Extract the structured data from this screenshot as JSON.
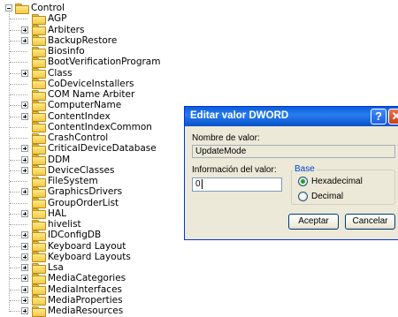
{
  "tree": {
    "root": "Control",
    "items": [
      {
        "label": "AGP",
        "expandable": false
      },
      {
        "label": "Arbiters",
        "expandable": true
      },
      {
        "label": "BackupRestore",
        "expandable": true
      },
      {
        "label": "Biosinfo",
        "expandable": false
      },
      {
        "label": "BootVerificationProgram",
        "expandable": false
      },
      {
        "label": "Class",
        "expandable": true
      },
      {
        "label": "CoDeviceInstallers",
        "expandable": false
      },
      {
        "label": "COM Name Arbiter",
        "expandable": false
      },
      {
        "label": "ComputerName",
        "expandable": true
      },
      {
        "label": "ContentIndex",
        "expandable": true
      },
      {
        "label": "ContentIndexCommon",
        "expandable": false
      },
      {
        "label": "CrashControl",
        "expandable": false
      },
      {
        "label": "CriticalDeviceDatabase",
        "expandable": true
      },
      {
        "label": "DDM",
        "expandable": true
      },
      {
        "label": "DeviceClasses",
        "expandable": true
      },
      {
        "label": "FileSystem",
        "expandable": false
      },
      {
        "label": "GraphicsDrivers",
        "expandable": true
      },
      {
        "label": "GroupOrderList",
        "expandable": false
      },
      {
        "label": "HAL",
        "expandable": true
      },
      {
        "label": "hivelist",
        "expandable": false
      },
      {
        "label": "IDConfigDB",
        "expandable": true
      },
      {
        "label": "Keyboard Layout",
        "expandable": true
      },
      {
        "label": "Keyboard Layouts",
        "expandable": true
      },
      {
        "label": "Lsa",
        "expandable": true
      },
      {
        "label": "MediaCategories",
        "expandable": true
      },
      {
        "label": "MediaInterfaces",
        "expandable": true
      },
      {
        "label": "MediaProperties",
        "expandable": true
      },
      {
        "label": "MediaResources",
        "expandable": true
      }
    ]
  },
  "dialog": {
    "title": "Editar valor DWORD",
    "help_glyph": "?",
    "close_glyph": "✕",
    "value_name_label": "Nombre de valor:",
    "value_name": "UpdateMode",
    "value_data_label": "Información del valor:",
    "value_data": "0",
    "base_label": "Base",
    "radio_hex": "Hexadecimal",
    "radio_dec": "Decimal",
    "selected_base": "Hexadecimal",
    "ok_label": "Aceptar",
    "cancel_label": "Cancelar"
  }
}
